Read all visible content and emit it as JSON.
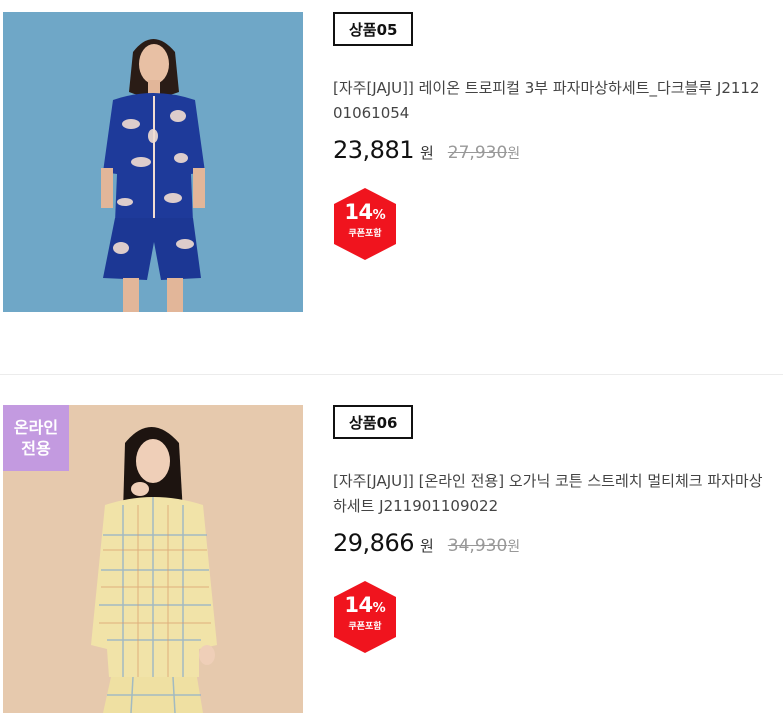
{
  "products": [
    {
      "code": "상품05",
      "title": "[자주[JAJU]] 레이온 트로피컬 3부 파자마상하세트_다크블루 J211201061054",
      "price": "23,881",
      "currency": "원",
      "original_price": "27,930",
      "original_currency": "원",
      "discount_num": "14",
      "discount_pct": "%",
      "discount_label": "쿠폰포함"
    },
    {
      "badge_line1": "온라인",
      "badge_line2": "전용",
      "code": "상품06",
      "title": "[자주[JAJU]] [온라인 전용] 오가닉 코튼 스트레치 멀티체크 파자마상하세트 J211901109022",
      "price": "29,866",
      "currency": "원",
      "original_price": "34,930",
      "original_currency": "원",
      "discount_num": "14",
      "discount_pct": "%",
      "discount_label": "쿠폰포함"
    }
  ],
  "colors": {
    "discount_red": "#f0141e",
    "badge_purple": "#c39ae0",
    "photo1_bg": "#6fa7c7",
    "photo2_bg": "#e6c9ad"
  }
}
